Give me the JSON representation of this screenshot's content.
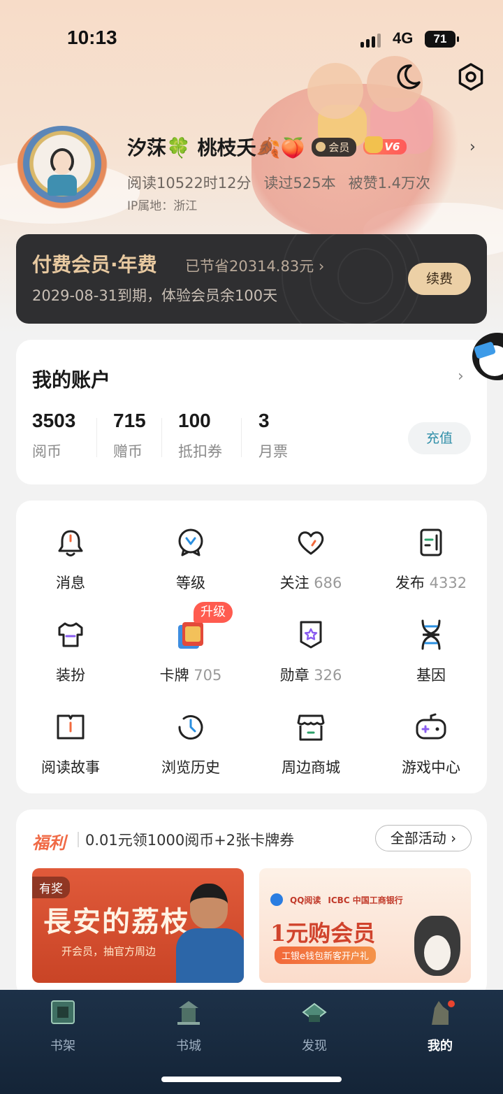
{
  "status_bar": {
    "time": "10:13",
    "network": "4G",
    "battery": "71"
  },
  "profile": {
    "nickname": "汐莯🍀 桃枝夭🍂🍑",
    "vip_badge": "会员",
    "level_badge": "V6",
    "stats": [
      "阅读10522时12分",
      "读过525本",
      "被赞1.4万次"
    ],
    "ip_location": "IP属地：浙江"
  },
  "vip_card": {
    "title": "付费会员·年费",
    "saved": "已节省20314.83元 ›",
    "expire": "2029-08-31到期，体验会员余100天",
    "renew_button": "续费"
  },
  "account": {
    "title": "我的账户",
    "items": [
      {
        "value": "3503",
        "label": "阅币"
      },
      {
        "value": "715",
        "label": "赠币"
      },
      {
        "value": "100",
        "label": "抵扣券"
      },
      {
        "value": "3",
        "label": "月票"
      }
    ],
    "recharge_button": "充值"
  },
  "features": [
    {
      "label": "消息",
      "count": "",
      "icon": "bell-icon"
    },
    {
      "label": "等级",
      "count": "",
      "icon": "level-icon"
    },
    {
      "label": "关注",
      "count": "686",
      "icon": "heart-icon"
    },
    {
      "label": "发布",
      "count": "4332",
      "icon": "publish-icon"
    },
    {
      "label": "装扮",
      "count": "",
      "icon": "shirt-icon"
    },
    {
      "label": "卡牌",
      "count": "705",
      "icon": "card-icon"
    },
    {
      "label": "勋章",
      "count": "326",
      "icon": "medal-icon"
    },
    {
      "label": "基因",
      "count": "",
      "icon": "dna-icon"
    },
    {
      "label": "阅读故事",
      "count": "",
      "icon": "book-icon"
    },
    {
      "label": "浏览历史",
      "count": "",
      "icon": "history-icon"
    },
    {
      "label": "周边商城",
      "count": "",
      "icon": "shop-icon"
    },
    {
      "label": "游戏中心",
      "count": "",
      "icon": "gamepad-icon"
    }
  ],
  "upgrade_tag": "升级",
  "welfare": {
    "label": "福利",
    "text": "0.01元领1000阅币+2张卡牌券",
    "all_button": "全部活动 ›",
    "banner_left": {
      "tag": "有奖",
      "title": "長安的荔枝",
      "subtitle": "开会员，抽官方周边"
    },
    "banner_right": {
      "logo_qq": "QQ阅读",
      "logo_bank": "ICBC 中国工商银行",
      "title": "1元购会员",
      "pill": "工银e钱包新客开户礼"
    }
  },
  "tabbar": {
    "tabs": [
      {
        "label": "书架",
        "icon": "bookshelf-icon"
      },
      {
        "label": "书城",
        "icon": "bookstore-icon"
      },
      {
        "label": "发现",
        "icon": "discover-icon"
      },
      {
        "label": "我的",
        "icon": "profile-icon"
      }
    ],
    "active": "我的"
  },
  "colors": {
    "accent": "#2f8ea8",
    "vip_gold": "#e8c9a0",
    "welfare_red": "#f06a46",
    "tabbar_bg": "#1d3148"
  }
}
